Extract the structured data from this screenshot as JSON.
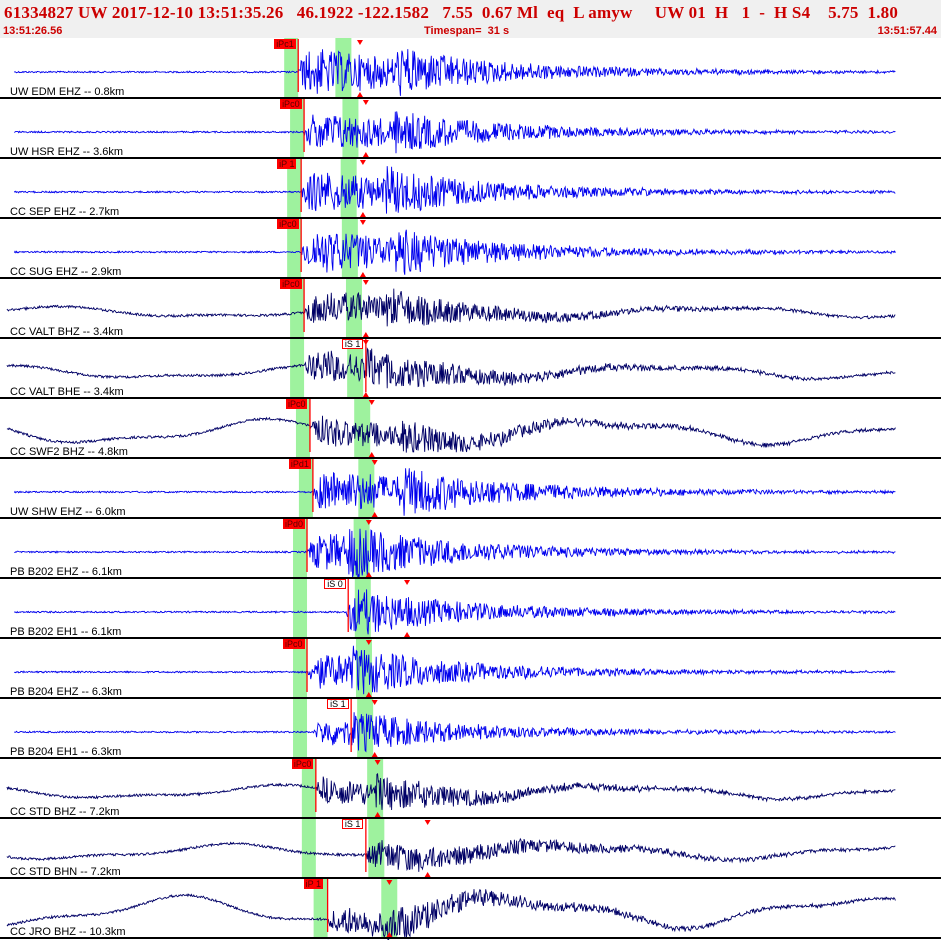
{
  "header": {
    "title": "61334827 UW 2017-12-10 13:51:35.26   46.1922 -122.1582   7.55  0.67 Ml  eq  L amyw     UW 01  H   1  -  H S4    5.75  1.80",
    "start_time": "13:51:26.56",
    "timespan": "Timespan=  31 s",
    "end_time": "13:51:57.44"
  },
  "colors": {
    "header_bg": "#f0f0f0",
    "header_text": "#cc0000",
    "trace_blue": "#0000ee",
    "trace_dark": "#000066",
    "pick_red": "#ff0000",
    "window_green": "#9ef29e"
  },
  "traces": [
    {
      "label": "UW EDM EHZ -- 0.8km",
      "color": "blue",
      "p_pick": "iPc1",
      "s_pick": "",
      "p_t": 10.0,
      "s_t": 13.3,
      "onset": 10.0,
      "lowfreq": 0,
      "amp": 1.0
    },
    {
      "label": "UW HSR EHZ -- 3.6km",
      "color": "blue",
      "p_pick": "iPc0",
      "s_pick": "",
      "p_t": 10.2,
      "s_t": 13.3,
      "onset": 10.2,
      "lowfreq": 0,
      "amp": 0.85
    },
    {
      "label": "CC SEP EHZ -- 2.7km",
      "color": "blue",
      "p_pick": "iP 1",
      "s_pick": "",
      "p_t": 10.1,
      "s_t": 13.0,
      "onset": 10.1,
      "lowfreq": 0,
      "amp": 0.9
    },
    {
      "label": "CC SUG EHZ -- 2.9km",
      "color": "blue",
      "p_pick": "iPc0",
      "s_pick": "",
      "p_t": 10.1,
      "s_t": 13.3,
      "onset": 10.1,
      "lowfreq": 0,
      "amp": 0.95
    },
    {
      "label": "CC VALT BHZ -- 3.4km",
      "color": "dark",
      "p_pick": "iPc0",
      "s_pick": "",
      "p_t": 10.2,
      "s_t": 13.0,
      "onset": 10.2,
      "lowfreq": 0.25,
      "amp": 0.7
    },
    {
      "label": "CC VALT BHE -- 3.4km",
      "color": "dark",
      "p_pick": "",
      "s_pick": "iS 1",
      "p_t": 10.2,
      "s_t": 12.3,
      "onset": 10.2,
      "lowfreq": 0.3,
      "amp": 0.7
    },
    {
      "label": "CC SWF2 BHZ -- 4.8km",
      "color": "dark",
      "p_pick": "iPc0",
      "s_pick": "",
      "p_t": 10.4,
      "s_t": 13.5,
      "onset": 10.4,
      "lowfreq": 0.55,
      "amp": 0.65
    },
    {
      "label": "UW SHW EHZ -- 6.0km",
      "color": "blue",
      "p_pick": "iPd1",
      "s_pick": "",
      "p_t": 10.5,
      "s_t": 13.6,
      "onset": 10.5,
      "lowfreq": 0,
      "amp": 0.95
    },
    {
      "label": "PB B202 EHZ -- 6.1km",
      "color": "blue",
      "p_pick": "iPd0",
      "s_pick": "",
      "p_t": 10.3,
      "s_t": 11.7,
      "onset": 10.3,
      "lowfreq": 0,
      "amp": 0.8
    },
    {
      "label": "PB B202 EH1 -- 6.1km",
      "color": "blue",
      "p_pick": "",
      "s_pick": "iS 0",
      "p_t": 10.3,
      "s_t": 11.7,
      "onset": 11.6,
      "lowfreq": 0,
      "amp": 0.6
    },
    {
      "label": "PB B204 EHZ -- 6.3km",
      "color": "blue",
      "p_pick": "iPc0",
      "s_pick": "",
      "p_t": 10.3,
      "s_t": 11.8,
      "onset": 10.3,
      "lowfreq": 0,
      "amp": 0.75
    },
    {
      "label": "PB B204 EH1 -- 6.3km",
      "color": "blue",
      "p_pick": "",
      "s_pick": "iS 1",
      "p_t": 10.3,
      "s_t": 11.8,
      "onset": 10.5,
      "lowfreq": 0,
      "amp": 0.6
    },
    {
      "label": "CC STD BHZ -- 7.2km",
      "color": "dark",
      "p_pick": "iPc0",
      "s_pick": "",
      "p_t": 10.6,
      "s_t": 12.6,
      "onset": 0,
      "lowfreq": 0.3,
      "amp": 0.6
    },
    {
      "label": "CC STD BHN -- 7.2km",
      "color": "dark",
      "p_pick": "",
      "s_pick": "iS 1",
      "p_t": 10.6,
      "s_t": 12.3,
      "onset": 12.3,
      "lowfreq": 0.35,
      "amp": 0.65
    },
    {
      "label": "CC JRO BHZ -- 10.3km",
      "color": "dark",
      "p_pick": "iP 1",
      "s_pick": "",
      "p_t": 11.0,
      "s_t": 13.0,
      "onset": 11.0,
      "lowfreq": 0.7,
      "amp": 0.6
    }
  ],
  "time": {
    "span_s": 31,
    "p_window": [
      9.9,
      10.5
    ],
    "s_window": [
      11.2,
      11.8
    ]
  }
}
